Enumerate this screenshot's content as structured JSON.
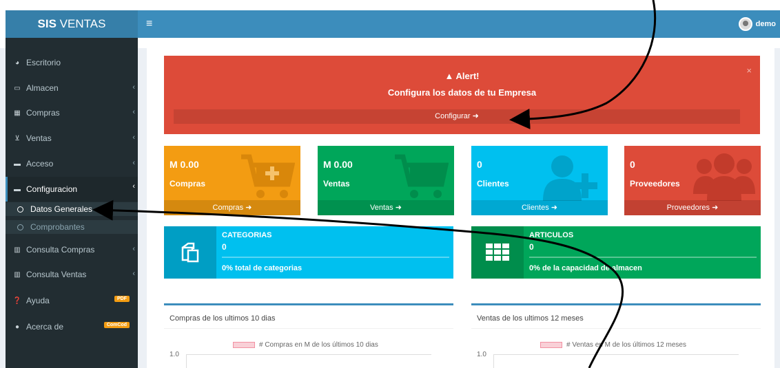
{
  "header": {
    "logo_bold": "SIS",
    "logo_rest": " VENTAS",
    "menu_toggle": "≡",
    "user_name": "demo"
  },
  "sidebar": {
    "items": [
      {
        "label": "Escritorio",
        "icon": "dashboard-icon"
      },
      {
        "label": "Almacen",
        "icon": "laptop-icon"
      },
      {
        "label": "Compras",
        "icon": "grid-icon"
      },
      {
        "label": "Ventas",
        "icon": "cart-icon"
      },
      {
        "label": "Acceso",
        "icon": "folder-icon"
      },
      {
        "label": "Configuracion",
        "icon": "folder-icon"
      },
      {
        "label": "Consulta Compras",
        "icon": "bar-chart-icon"
      },
      {
        "label": "Consulta Ventas",
        "icon": "bar-chart-icon"
      },
      {
        "label": "Ayuda",
        "icon": "question-icon",
        "badge": "PDF"
      },
      {
        "label": "Acerca de",
        "icon": "info-icon",
        "badge": "ComCod"
      }
    ],
    "sub_items": [
      {
        "label": "Datos Generales"
      },
      {
        "label": "Comprobantes"
      }
    ]
  },
  "alert": {
    "title": "Alert!",
    "message": "Configura los datos de tu Empresa",
    "button": "Configurar",
    "close": "×"
  },
  "boxes": [
    {
      "value": "M 0.00",
      "label": "Compras",
      "footer": "Compras",
      "color": "#f39c12",
      "icon": "cart-plus-icon"
    },
    {
      "value": "M 0.00",
      "label": "Ventas",
      "footer": "Ventas",
      "color": "#00a65a",
      "icon": "cart-icon"
    },
    {
      "value": "0",
      "label": "Clientes",
      "footer": "Clientes",
      "color": "#00c0ef",
      "icon": "user-plus-icon"
    },
    {
      "value": "0",
      "label": "Proveedores",
      "footer": "Proveedores",
      "color": "#dd4b39",
      "icon": "users-icon"
    }
  ],
  "wide_boxes": [
    {
      "title": "CATEGORIAS",
      "value": "0",
      "desc": "0% total de categorias",
      "color": "#00c0ef",
      "icon": "copy-icon"
    },
    {
      "title": "ARTICULOS",
      "value": "0",
      "desc": "0% de la capacidad de almacen",
      "color": "#00a65a",
      "icon": "grid-icon"
    }
  ],
  "panels": [
    {
      "title": "Compras de los ultimos 10 dias",
      "legend": "# Compras en M de los últimos 10 dias",
      "tick": "1.0"
    },
    {
      "title": "Ventas de los ultimos 12 meses",
      "legend": "# Ventas en M de los últimos 12 meses",
      "tick": "1.0"
    }
  ]
}
